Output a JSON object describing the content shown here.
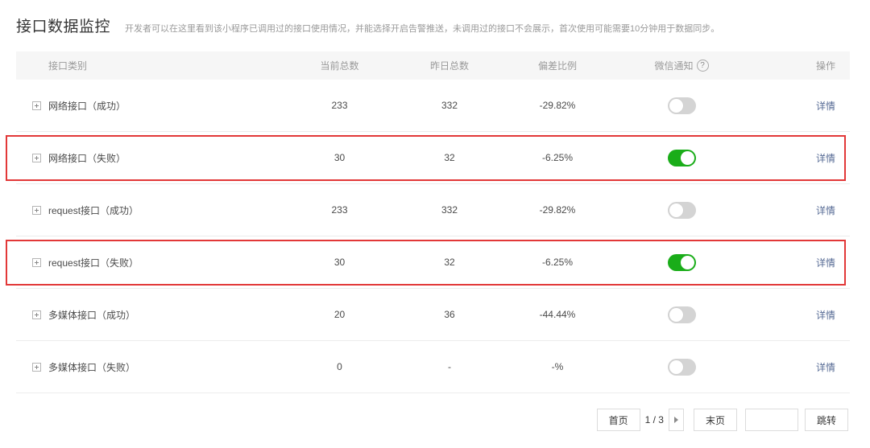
{
  "header": {
    "title": "接口数据监控",
    "description": "开发者可以在这里看到该小程序已调用过的接口使用情况，并能选择开启告警推送，未调用过的接口不会展示，首次使用可能需要10分钟用于数据同步。"
  },
  "table": {
    "columns": {
      "name": "接口类别",
      "current": "当前总数",
      "yesterday": "昨日总数",
      "deviation": "偏差比例",
      "notify": "微信通知",
      "notify_help": "?",
      "op": "操作"
    },
    "rows": [
      {
        "name": "网络接口（成功）",
        "current": "233",
        "yesterday": "332",
        "deviation": "-29.82%",
        "notify_on": false,
        "op": "详情",
        "highlighted": false
      },
      {
        "name": "网络接口（失败）",
        "current": "30",
        "yesterday": "32",
        "deviation": "-6.25%",
        "notify_on": true,
        "op": "详情",
        "highlighted": true
      },
      {
        "name": "request接口（成功）",
        "current": "233",
        "yesterday": "332",
        "deviation": "-29.82%",
        "notify_on": false,
        "op": "详情",
        "highlighted": false
      },
      {
        "name": "request接口（失败）",
        "current": "30",
        "yesterday": "32",
        "deviation": "-6.25%",
        "notify_on": true,
        "op": "详情",
        "highlighted": true
      },
      {
        "name": "多媒体接口（成功）",
        "current": "20",
        "yesterday": "36",
        "deviation": "-44.44%",
        "notify_on": false,
        "op": "详情",
        "highlighted": false
      },
      {
        "name": "多媒体接口（失败）",
        "current": "0",
        "yesterday": "-",
        "deviation": "-%",
        "notify_on": false,
        "op": "详情",
        "highlighted": false
      }
    ]
  },
  "pager": {
    "first": "首页",
    "info": "1 / 3",
    "last": "末页",
    "jump_value": "",
    "jump": "跳转"
  },
  "colors": {
    "toggle_on": "#1aad19",
    "highlight_border": "#e23838",
    "link": "#576b95"
  }
}
